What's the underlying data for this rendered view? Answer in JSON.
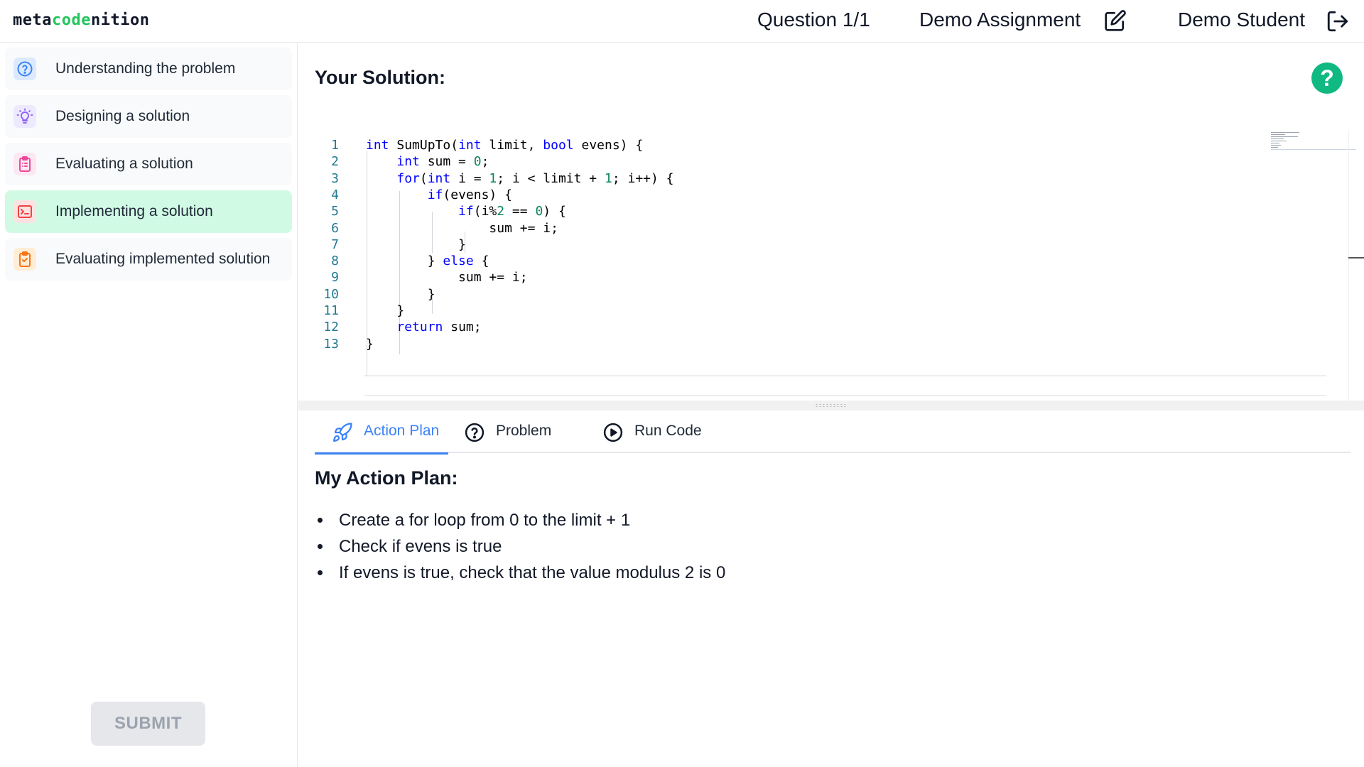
{
  "header": {
    "logo_prefix": "meta",
    "logo_accent": "code",
    "logo_suffix": "nition",
    "question": "Question 1/1",
    "assignment": "Demo Assignment",
    "student": "Demo Student"
  },
  "sidebar": {
    "steps": [
      {
        "label": "Understanding the problem",
        "icon": "question-circle-icon",
        "color": "#3b82f6",
        "bg": "#dbeafe"
      },
      {
        "label": "Designing a solution",
        "icon": "lightbulb-icon",
        "color": "#8b5cf6",
        "bg": "#ede9fe"
      },
      {
        "label": "Evaluating a solution",
        "icon": "clipboard-list-icon",
        "color": "#ec4899",
        "bg": "#fce7f3"
      },
      {
        "label": "Implementing a solution",
        "icon": "terminal-icon",
        "color": "#ef4444",
        "bg": "#fee2e2",
        "active": true
      },
      {
        "label": "Evaluating implemented solution",
        "icon": "clipboard-check-icon",
        "color": "#f97316",
        "bg": "#ffedd5"
      }
    ],
    "submit_label": "SUBMIT"
  },
  "main": {
    "title": "Your Solution:",
    "help_label": "?"
  },
  "editor": {
    "language": "C#",
    "lines": [
      {
        "n": "1",
        "code": "int SumUpTo(int limit, bool evens) {"
      },
      {
        "n": "2",
        "code": "    int sum = 0;"
      },
      {
        "n": "3",
        "code": "    for(int i = 1; i < limit + 1; i++) {"
      },
      {
        "n": "4",
        "code": "        if(evens) {"
      },
      {
        "n": "5",
        "code": "            if(i%2 == 0) {"
      },
      {
        "n": "6",
        "code": "                sum += i;"
      },
      {
        "n": "7",
        "code": "            }"
      },
      {
        "n": "8",
        "code": "        } else {"
      },
      {
        "n": "9",
        "code": "            sum += i;"
      },
      {
        "n": "10",
        "code": "        }"
      },
      {
        "n": "11",
        "code": "    }"
      },
      {
        "n": "12",
        "code": "    return sum;"
      },
      {
        "n": "13",
        "code": "}"
      }
    ]
  },
  "tabs": [
    {
      "label": "Action Plan",
      "icon": "rocket-icon",
      "active": true
    },
    {
      "label": "Problem",
      "icon": "question-circle-icon"
    },
    {
      "label": "Run Code",
      "icon": "play-circle-icon"
    }
  ],
  "action_plan": {
    "title": "My Action Plan:",
    "items": [
      "Create a for loop from 0 to the limit + 1",
      "Check if evens is true",
      "If evens is true, check that the value modulus 2 is 0"
    ]
  }
}
